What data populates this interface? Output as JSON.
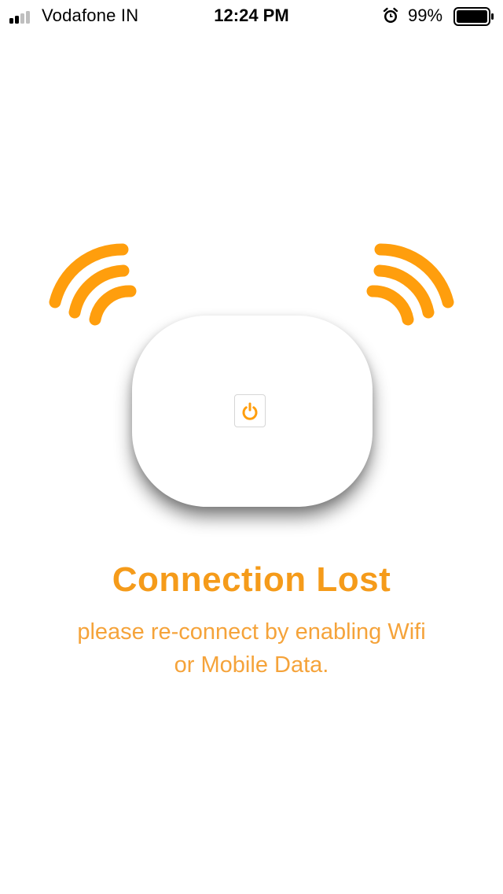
{
  "status_bar": {
    "carrier": "Vodafone IN",
    "time": "12:24 PM",
    "battery_percent": "99%",
    "signal_bars": 2,
    "icons": [
      "signal-icon",
      "alarm-icon",
      "battery-icon"
    ]
  },
  "colors": {
    "accent": "#ff9e0d",
    "text_accent": "#f59b1a"
  },
  "main": {
    "title": "Connection Lost",
    "message_line1": "please re-connect by enabling Wifi",
    "message_line2": "or Mobile Data.",
    "device_icon": "power-icon"
  }
}
